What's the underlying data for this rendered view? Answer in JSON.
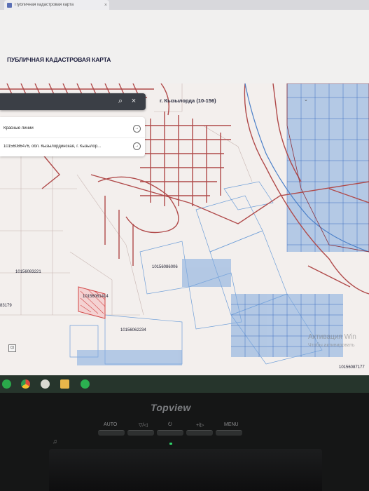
{
  "browser": {
    "tab_title": "Публичная кадастровая карта",
    "tab_close": "×"
  },
  "header": {
    "title": "ПУБЛИЧНАЯ КАДАСТРОВАЯ КАРТА"
  },
  "search": {
    "value": "",
    "placeholder": "",
    "search_icon": "⌕",
    "close_icon": "×"
  },
  "results": {
    "items": [
      {
        "label": "Красные линии",
        "arrow": "→"
      },
      {
        "label": "10156086476, обл. Кызылординская, г. Кызылор...",
        "arrow": "→"
      }
    ]
  },
  "region": {
    "label": "г. Кызылорда (10-156)",
    "chevron": "⌄"
  },
  "map": {
    "parcels": [
      "10156086006",
      "10156083221",
      "10156061414",
      "10156062234",
      "83179",
      "10156087177"
    ],
    "watermark_line1": "Активация Win",
    "watermark_line2": "Чтобы активировать",
    "tool_icon": "⊡",
    "colors": {
      "background": "#f3efed",
      "red_lines": "#b04a4a",
      "parcel_outline": "#6f9fd8",
      "parcel_dense": "#3f6fbf",
      "highlight": "#d24747"
    }
  },
  "taskbar": {
    "icons": [
      "app-green",
      "chrome",
      "tool",
      "folder",
      "app-green-2"
    ]
  },
  "monitor": {
    "brand": "Topview",
    "controls": [
      "AUTO",
      "▽/◁",
      "⏻",
      "+/▷",
      "MENU"
    ],
    "headphone_icon": "♫"
  }
}
